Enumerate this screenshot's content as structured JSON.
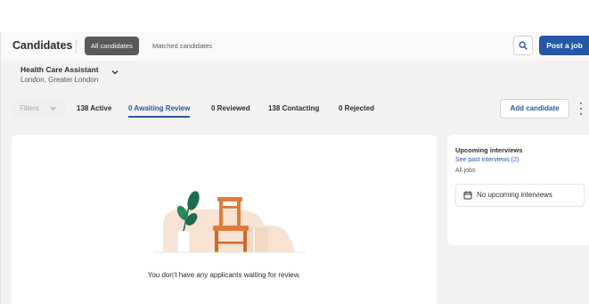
{
  "header": {
    "title": "Candidates",
    "tabs": [
      {
        "label": "All candidates",
        "selected": true
      },
      {
        "label": "Matched candidates",
        "selected": false
      }
    ],
    "search_icon": "search-icon",
    "post_job_label": "Post a job"
  },
  "job": {
    "title": "Health Care Assistant",
    "location": "London, Greater London",
    "chevron_icon": "chevron-down-icon"
  },
  "status_bar": {
    "filters_label": "Filters",
    "items": [
      {
        "label": "138 Active",
        "active": false
      },
      {
        "label": "0 Awaiting Review",
        "active": true
      },
      {
        "label": "0 Reviewed",
        "active": false
      },
      {
        "label": "138 Contacting",
        "active": false
      },
      {
        "label": "0 Rejected",
        "active": false
      }
    ],
    "add_candidate_label": "Add candidate"
  },
  "empty_state": {
    "message": "You don't have any applicants waiting for review.",
    "illustration": "chair-and-plant-illustration"
  },
  "side_panel": {
    "title": "Upcoming interviews",
    "link": "See past interviews (2)",
    "subtitle": "All jobs",
    "no_interviews": "No upcoming interviews",
    "calendar_icon": "calendar-icon"
  },
  "colors": {
    "accent": "#2557a7",
    "tab_selected_bg": "#595959",
    "page_bg": "#f3f2f1",
    "illustration_peach": "#f8e3d3",
    "chair": "#e07a3a",
    "plant": "#1f6b4f"
  }
}
